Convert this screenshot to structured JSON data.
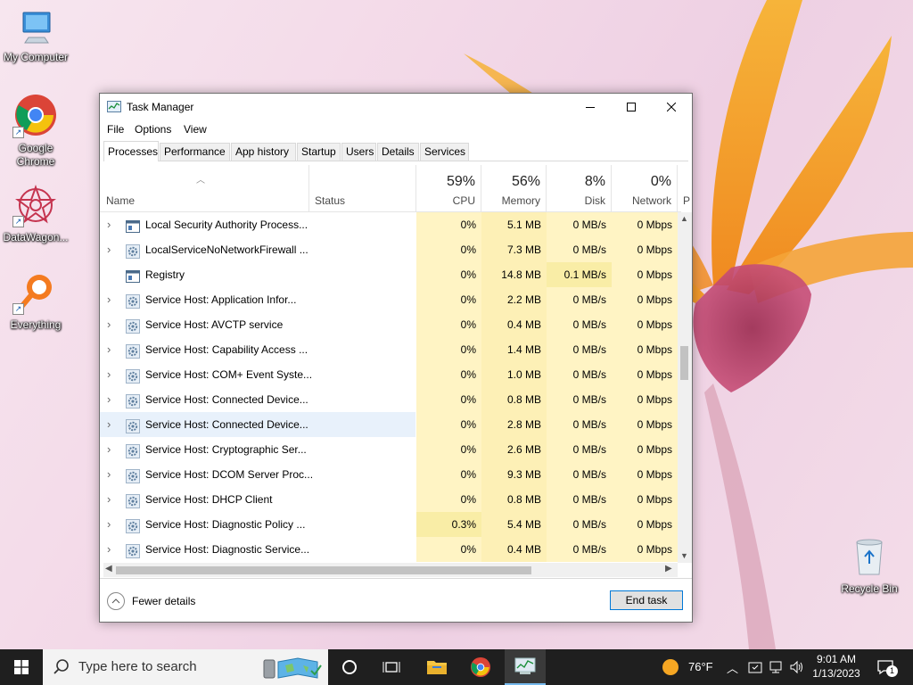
{
  "desktop": {
    "icons": [
      {
        "label": "My Computer"
      },
      {
        "label": "Google Chrome"
      },
      {
        "label": "DataWagon..."
      },
      {
        "label": "Everything"
      },
      {
        "label": "Recycle Bin"
      }
    ]
  },
  "window": {
    "title": "Task Manager",
    "menu": [
      "File",
      "Options",
      "View"
    ],
    "tabs": [
      "Processes",
      "Performance",
      "App history",
      "Startup",
      "Users",
      "Details",
      "Services"
    ],
    "active_tab": "Processes",
    "columns": {
      "name": "Name",
      "status": "Status",
      "cpu": {
        "label": "CPU",
        "pct": "59%"
      },
      "memory": {
        "label": "Memory",
        "pct": "56%"
      },
      "disk": {
        "label": "Disk",
        "pct": "8%"
      },
      "network": {
        "label": "Network",
        "pct": "0%"
      },
      "power_partial": "P"
    },
    "rows": [
      {
        "name": "Local Security Authority Process...",
        "icon": "window-icon",
        "expand": true,
        "cpu": "0%",
        "mem": "5.1 MB",
        "disk": "0 MB/s",
        "net": "0 Mbps"
      },
      {
        "name": "LocalServiceNoNetworkFirewall ...",
        "icon": "gear-icon",
        "expand": true,
        "cpu": "0%",
        "mem": "7.3 MB",
        "disk": "0 MB/s",
        "net": "0 Mbps"
      },
      {
        "name": "Registry",
        "icon": "window-icon",
        "expand": false,
        "cpu": "0%",
        "mem": "14.8 MB",
        "disk": "0.1 MB/s",
        "net": "0 Mbps"
      },
      {
        "name": "Service Host: Application Infor...",
        "icon": "gear-icon",
        "expand": true,
        "cpu": "0%",
        "mem": "2.2 MB",
        "disk": "0 MB/s",
        "net": "0 Mbps"
      },
      {
        "name": "Service Host: AVCTP service",
        "icon": "gear-icon",
        "expand": true,
        "cpu": "0%",
        "mem": "0.4 MB",
        "disk": "0 MB/s",
        "net": "0 Mbps"
      },
      {
        "name": "Service Host: Capability Access ...",
        "icon": "gear-icon",
        "expand": true,
        "cpu": "0%",
        "mem": "1.4 MB",
        "disk": "0 MB/s",
        "net": "0 Mbps"
      },
      {
        "name": "Service Host: COM+ Event Syste...",
        "icon": "gear-icon",
        "expand": true,
        "cpu": "0%",
        "mem": "1.0 MB",
        "disk": "0 MB/s",
        "net": "0 Mbps"
      },
      {
        "name": "Service Host: Connected Device...",
        "icon": "gear-icon",
        "expand": true,
        "cpu": "0%",
        "mem": "0.8 MB",
        "disk": "0 MB/s",
        "net": "0 Mbps"
      },
      {
        "name": "Service Host: Connected Device...",
        "icon": "gear-icon",
        "expand": true,
        "cpu": "0%",
        "mem": "2.8 MB",
        "disk": "0 MB/s",
        "net": "0 Mbps",
        "selected": true
      },
      {
        "name": "Service Host: Cryptographic Ser...",
        "icon": "gear-icon",
        "expand": true,
        "cpu": "0%",
        "mem": "2.6 MB",
        "disk": "0 MB/s",
        "net": "0 Mbps"
      },
      {
        "name": "Service Host: DCOM Server Proc...",
        "icon": "gear-icon",
        "expand": true,
        "cpu": "0%",
        "mem": "9.3 MB",
        "disk": "0 MB/s",
        "net": "0 Mbps"
      },
      {
        "name": "Service Host: DHCP Client",
        "icon": "gear-icon",
        "expand": true,
        "cpu": "0%",
        "mem": "0.8 MB",
        "disk": "0 MB/s",
        "net": "0 Mbps"
      },
      {
        "name": "Service Host: Diagnostic Policy ...",
        "icon": "gear-icon",
        "expand": true,
        "cpu": "0.3%",
        "mem": "5.4 MB",
        "disk": "0 MB/s",
        "net": "0 Mbps"
      },
      {
        "name": "Service Host: Diagnostic Service...",
        "icon": "gear-icon",
        "expand": true,
        "cpu": "0%",
        "mem": "0.4 MB",
        "disk": "0 MB/s",
        "net": "0 Mbps"
      }
    ],
    "footer": {
      "fewer_details": "Fewer details",
      "end_task": "End task"
    }
  },
  "taskbar": {
    "search_placeholder": "Type here to search",
    "weather": "76°F",
    "time": "9:01 AM",
    "date": "1/13/2023",
    "notification_count": "1"
  },
  "colors": {
    "cpu_bg": "#fff4c4",
    "cpu_bg_hi": "#f9eda6",
    "mem_bg": "#fdf0b6",
    "accent": "#0078d7",
    "taskbar": "#1f1f1f"
  }
}
